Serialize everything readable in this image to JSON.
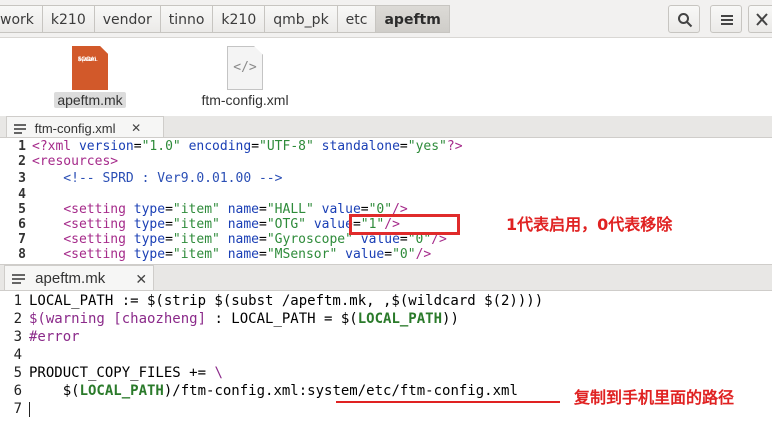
{
  "pathbar": {
    "crumbs": [
      "work",
      "k210",
      "vendor",
      "tinno",
      "k210",
      "qmb_pk",
      "etc",
      "apeftm"
    ],
    "active_crumb": "apeftm",
    "search_icon": "search-icon",
    "menu_icon": "hamburger-menu-icon",
    "close_icon": "close-icon"
  },
  "files": [
    {
      "name": "apeftm.mk",
      "selected": true,
      "icon_lines": [
        "LOCAL",
        "$(warn",
        "#error"
      ]
    },
    {
      "name": "ftm-config.xml",
      "selected": false,
      "icon_glyph": "</>"
    }
  ],
  "editor1": {
    "tab_label": "ftm-config.xml",
    "tab_close": "✕",
    "lines": [
      {
        "n": "1",
        "text": "<?xml version=\"1.0\" encoding=\"UTF-8\" standalone=\"yes\"?>"
      },
      {
        "n": "2",
        "text": "<resources>"
      },
      {
        "n": "3",
        "text": "    <!-- SPRD : Ver9.0.01.00 -->"
      },
      {
        "n": "4",
        "text": ""
      },
      {
        "n": "5",
        "text": "    <setting type=\"item\" name=\"HALL\" value=\"0\"/>"
      },
      {
        "n": "6",
        "text": "    <setting type=\"item\" name=\"OTG\" value=\"1\"/>"
      },
      {
        "n": "7",
        "text": "    <setting type=\"item\" name=\"Gyroscope\" value=\"0\"/>"
      },
      {
        "n": "8",
        "text": "    <setting type=\"item\" name=\"MSensor\" value=\"0\"/>"
      }
    ],
    "annotation": "1代表启用，0代表移除"
  },
  "editor2": {
    "tab_label": "apeftm.mk",
    "tab_close": "✕",
    "lines": [
      {
        "n": "1",
        "text": "LOCAL_PATH := $(strip $(subst /apeftm.mk, ,$(wildcard $(2))))"
      },
      {
        "n": "2",
        "text": "$(warning [chaozheng] : LOCAL_PATH = $(LOCAL_PATH))"
      },
      {
        "n": "3",
        "text": "#error"
      },
      {
        "n": "4",
        "text": ""
      },
      {
        "n": "5",
        "text": "PRODUCT_COPY_FILES += \\"
      },
      {
        "n": "6",
        "text": "    $(LOCAL_PATH)/ftm-config.xml:system/etc/ftm-config.xml"
      },
      {
        "n": "7",
        "text": ""
      }
    ],
    "annotation": "复制到手机里面的路径"
  },
  "colors": {
    "annotation_red": "#e02222",
    "xml_tag": "#a52a8a",
    "xml_attr": "#1a3fb5",
    "xml_string": "#2e8b3a",
    "mk_bold_var": "#2a7a2a"
  }
}
